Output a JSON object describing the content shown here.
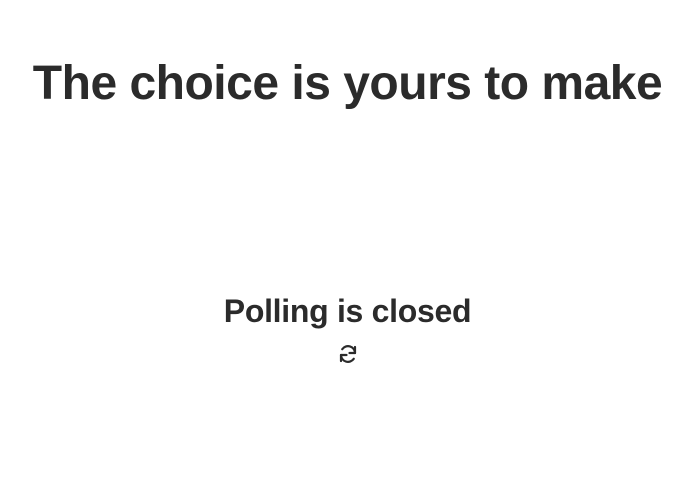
{
  "header": {
    "title": "The choice is yours to make"
  },
  "status": {
    "message": "Polling is closed",
    "refresh_icon": "refresh-icon"
  }
}
